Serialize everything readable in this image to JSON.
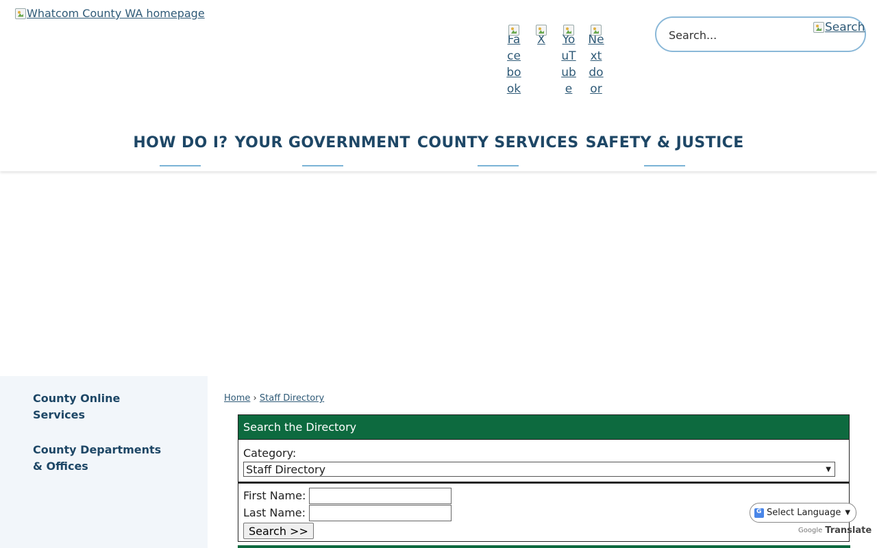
{
  "header": {
    "logo_alt": "Whatcom County WA homepage",
    "social": [
      "Facebook",
      "X",
      "YouTube",
      "Nextdoor"
    ],
    "search_placeholder": "Search...",
    "search_button": "Search"
  },
  "nav": {
    "items": [
      "HOW DO I?",
      "YOUR GOVERNMENT",
      "COUNTY SERVICES",
      "SAFETY & JUSTICE"
    ]
  },
  "sidebar": {
    "items": [
      "County Online Services",
      "County Departments & Offices"
    ],
    "items_lines": [
      [
        "County Online",
        "Services"
      ],
      [
        "County Departments",
        "& Offices"
      ]
    ]
  },
  "breadcrumb": {
    "home": "Home",
    "separator": "›",
    "current": "Staff Directory"
  },
  "directory": {
    "heading": "Search the Directory",
    "category_label": "Category:",
    "category_value": "Staff Directory",
    "first_name_label": "First Name:",
    "last_name_label": "Last Name:",
    "search_button": "Search >>"
  },
  "translate": {
    "select_label": "Select Language",
    "powered_by": "Google",
    "brand": "Translate"
  },
  "colors": {
    "nav_text": "#1e4766",
    "link": "#2f5a77",
    "directory_header": "#0d6a3f",
    "sidebar_bg": "#f2f6fa",
    "nav_underline": "#7ab3d6"
  }
}
